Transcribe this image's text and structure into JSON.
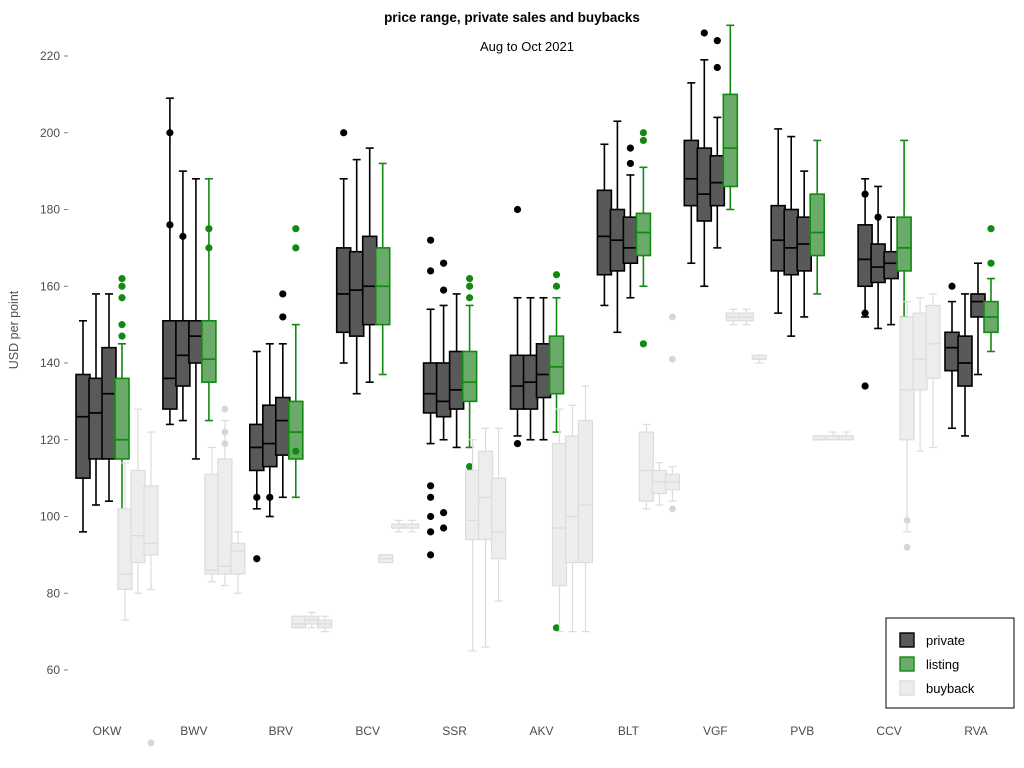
{
  "chart_data": {
    "type": "boxplot",
    "title": "price range, private sales and buybacks",
    "subtitle": "Aug to Oct 2021",
    "xlabel": "",
    "ylabel": "USD per point",
    "ylim": [
      52,
      232
    ],
    "yticks": [
      60,
      80,
      100,
      120,
      140,
      160,
      180,
      200,
      220
    ],
    "grid": false,
    "legend_position": "bottom-right",
    "legend": [
      {
        "label": "private",
        "color": "#595959",
        "border": "#000000"
      },
      {
        "label": "listing",
        "color": "#6aab6a",
        "border": "#128a12"
      },
      {
        "label": "buyback",
        "color": "#ededed",
        "border": "#dcdcdc"
      }
    ],
    "categories": [
      "OKW",
      "BWV",
      "BRV",
      "BCV",
      "SSR",
      "AKV",
      "BLT",
      "VGF",
      "PVB",
      "CCV",
      "RVA"
    ],
    "groups": [
      {
        "category": "OKW",
        "boxes": [
          {
            "series": "private",
            "min": 96,
            "q1": 110,
            "median": 126,
            "q3": 137,
            "max": 151,
            "outliers": []
          },
          {
            "series": "private",
            "min": 103,
            "q1": 115,
            "median": 127,
            "q3": 136,
            "max": 158,
            "outliers": []
          },
          {
            "series": "private",
            "min": 104,
            "q1": 115,
            "median": 132,
            "q3": 144,
            "max": 158,
            "outliers": []
          },
          {
            "series": "listing",
            "min": 99,
            "q1": 115,
            "median": 120,
            "q3": 136,
            "max": 145,
            "outliers": [
              157,
              160,
              162,
              150,
              147,
              97,
              99
            ]
          },
          {
            "series": "buyback",
            "min": 73,
            "q1": 81,
            "median": 85,
            "q3": 102,
            "max": 114,
            "outliers": []
          },
          {
            "series": "buyback",
            "min": 80,
            "q1": 88,
            "median": 95,
            "q3": 112,
            "max": 128,
            "outliers": []
          },
          {
            "series": "buyback",
            "min": 81,
            "q1": 90,
            "median": 93,
            "q3": 108,
            "max": 122,
            "outliers": [
              41
            ]
          }
        ]
      },
      {
        "category": "BWV",
        "boxes": [
          {
            "series": "private",
            "min": 124,
            "q1": 128,
            "median": 136,
            "q3": 151,
            "max": 209,
            "outliers": [
              200,
              176
            ]
          },
          {
            "series": "private",
            "min": 125,
            "q1": 134,
            "median": 142,
            "q3": 151,
            "max": 190,
            "outliers": [
              173
            ]
          },
          {
            "series": "private",
            "min": 115,
            "q1": 140,
            "median": 147,
            "q3": 151,
            "max": 188,
            "outliers": []
          },
          {
            "series": "listing",
            "min": 125,
            "q1": 135,
            "median": 141,
            "q3": 151,
            "max": 188,
            "outliers": [
              175,
              170
            ]
          },
          {
            "series": "buyback",
            "min": 83,
            "q1": 85,
            "median": 86,
            "q3": 111,
            "max": 118,
            "outliers": []
          },
          {
            "series": "buyback",
            "min": 82,
            "q1": 85,
            "median": 87,
            "q3": 115,
            "max": 125,
            "outliers": [
              119,
              122,
              128
            ]
          },
          {
            "series": "buyback",
            "min": 80,
            "q1": 85,
            "median": 91,
            "q3": 93,
            "max": 96,
            "outliers": []
          }
        ]
      },
      {
        "category": "BRV",
        "boxes": [
          {
            "series": "private",
            "min": 102,
            "q1": 112,
            "median": 118,
            "q3": 124,
            "max": 143,
            "outliers": [
              105,
              89
            ]
          },
          {
            "series": "private",
            "min": 100,
            "q1": 113,
            "median": 119,
            "q3": 129,
            "max": 145,
            "outliers": [
              105
            ]
          },
          {
            "series": "private",
            "min": 105,
            "q1": 116,
            "median": 125,
            "q3": 131,
            "max": 145,
            "outliers": [
              152,
              158
            ]
          },
          {
            "series": "listing",
            "min": 105,
            "q1": 115,
            "median": 122,
            "q3": 130,
            "max": 150,
            "outliers": [
              175,
              170,
              117
            ]
          },
          {
            "series": "buyback",
            "min": 71,
            "q1": 71,
            "median": 72,
            "q3": 74,
            "max": 74,
            "outliers": []
          },
          {
            "series": "buyback",
            "min": 71,
            "q1": 72,
            "median": 73,
            "q3": 74,
            "max": 75,
            "outliers": []
          },
          {
            "series": "buyback",
            "min": 70,
            "q1": 71,
            "median": 72,
            "q3": 73,
            "max": 74,
            "outliers": []
          }
        ]
      },
      {
        "category": "BCV",
        "boxes": [
          {
            "series": "private",
            "min": 140,
            "q1": 148,
            "median": 158,
            "q3": 170,
            "max": 188,
            "outliers": [
              200
            ]
          },
          {
            "series": "private",
            "min": 132,
            "q1": 147,
            "median": 159,
            "q3": 169,
            "max": 193,
            "outliers": []
          },
          {
            "series": "private",
            "min": 135,
            "q1": 150,
            "median": 160,
            "q3": 173,
            "max": 196,
            "outliers": []
          },
          {
            "series": "listing",
            "min": 137,
            "q1": 150,
            "median": 160,
            "q3": 170,
            "max": 192,
            "outliers": []
          },
          {
            "series": "buyback",
            "min": 88,
            "q1": 88,
            "median": 89,
            "q3": 90,
            "max": 90,
            "outliers": []
          },
          {
            "series": "buyback",
            "min": 96,
            "q1": 97,
            "median": 97,
            "q3": 98,
            "max": 99,
            "outliers": []
          },
          {
            "series": "buyback",
            "min": 96,
            "q1": 97,
            "median": 97,
            "q3": 98,
            "max": 99,
            "outliers": []
          }
        ]
      },
      {
        "category": "SSR",
        "boxes": [
          {
            "series": "private",
            "min": 119,
            "q1": 127,
            "median": 132,
            "q3": 140,
            "max": 154,
            "outliers": [
              172,
              164,
              108,
              105,
              100,
              96,
              90
            ]
          },
          {
            "series": "private",
            "min": 120,
            "q1": 126,
            "median": 130,
            "q3": 140,
            "max": 155,
            "outliers": [
              166,
              159,
              101,
              97
            ]
          },
          {
            "series": "private",
            "min": 118,
            "q1": 128,
            "median": 133,
            "q3": 143,
            "max": 158,
            "outliers": []
          },
          {
            "series": "listing",
            "min": 118,
            "q1": 130,
            "median": 135,
            "q3": 143,
            "max": 155,
            "outliers": [
              160,
              162,
              157,
              113
            ]
          },
          {
            "series": "buyback",
            "min": 65,
            "q1": 94,
            "median": 99,
            "q3": 112,
            "max": 120,
            "outliers": []
          },
          {
            "series": "buyback",
            "min": 66,
            "q1": 94,
            "median": 105,
            "q3": 117,
            "max": 123,
            "outliers": []
          },
          {
            "series": "buyback",
            "min": 78,
            "q1": 89,
            "median": 96,
            "q3": 110,
            "max": 123,
            "outliers": []
          }
        ]
      },
      {
        "category": "AKV",
        "boxes": [
          {
            "series": "private",
            "min": 121,
            "q1": 128,
            "median": 134,
            "q3": 142,
            "max": 157,
            "outliers": [
              180,
              119
            ]
          },
          {
            "series": "private",
            "min": 120,
            "q1": 128,
            "median": 135,
            "q3": 142,
            "max": 157,
            "outliers": []
          },
          {
            "series": "private",
            "min": 120,
            "q1": 131,
            "median": 137,
            "q3": 145,
            "max": 157,
            "outliers": []
          },
          {
            "series": "listing",
            "min": 122,
            "q1": 132,
            "median": 139,
            "q3": 147,
            "max": 157,
            "outliers": [
              163,
              160,
              71
            ]
          },
          {
            "series": "buyback",
            "min": 70,
            "q1": 82,
            "median": 97,
            "q3": 119,
            "max": 128,
            "outliers": []
          },
          {
            "series": "buyback",
            "min": 70,
            "q1": 88,
            "median": 100,
            "q3": 121,
            "max": 129,
            "outliers": []
          },
          {
            "series": "buyback",
            "min": 70,
            "q1": 88,
            "median": 103,
            "q3": 125,
            "max": 134,
            "outliers": []
          }
        ]
      },
      {
        "category": "BLT",
        "boxes": [
          {
            "series": "private",
            "min": 155,
            "q1": 163,
            "median": 173,
            "q3": 185,
            "max": 197,
            "outliers": []
          },
          {
            "series": "private",
            "min": 148,
            "q1": 164,
            "median": 172,
            "q3": 180,
            "max": 203,
            "outliers": []
          },
          {
            "series": "private",
            "min": 157,
            "q1": 166,
            "median": 170,
            "q3": 178,
            "max": 189,
            "outliers": [
              196,
              192
            ]
          },
          {
            "series": "listing",
            "min": 160,
            "q1": 168,
            "median": 174,
            "q3": 179,
            "max": 191,
            "outliers": [
              198,
              200,
              145
            ]
          },
          {
            "series": "buyback",
            "min": 102,
            "q1": 104,
            "median": 112,
            "q3": 122,
            "max": 124,
            "outliers": []
          },
          {
            "series": "buyback",
            "min": 103,
            "q1": 106,
            "median": 109,
            "q3": 112,
            "max": 114,
            "outliers": []
          },
          {
            "series": "buyback",
            "min": 104,
            "q1": 107,
            "median": 109,
            "q3": 111,
            "max": 113,
            "outliers": [
              102,
              152,
              141
            ]
          }
        ]
      },
      {
        "category": "VGF",
        "boxes": [
          {
            "series": "private",
            "min": 166,
            "q1": 181,
            "median": 188,
            "q3": 198,
            "max": 213,
            "outliers": []
          },
          {
            "series": "private",
            "min": 160,
            "q1": 177,
            "median": 184,
            "q3": 196,
            "max": 219,
            "outliers": [
              226
            ]
          },
          {
            "series": "private",
            "min": 170,
            "q1": 181,
            "median": 187,
            "q3": 194,
            "max": 204,
            "outliers": [
              224,
              217
            ]
          },
          {
            "series": "listing",
            "min": 180,
            "q1": 186,
            "median": 196,
            "q3": 210,
            "max": 228,
            "outliers": []
          },
          {
            "series": "buyback",
            "min": 150,
            "q1": 151,
            "median": 152,
            "q3": 153,
            "max": 154,
            "outliers": []
          },
          {
            "series": "buyback",
            "min": 150,
            "q1": 151,
            "median": 152,
            "q3": 153,
            "max": 154,
            "outliers": []
          },
          {
            "series": "buyback",
            "min": 140,
            "q1": 141,
            "median": 141,
            "q3": 142,
            "max": 142,
            "outliers": []
          }
        ]
      },
      {
        "category": "PVB",
        "boxes": [
          {
            "series": "private",
            "min": 153,
            "q1": 164,
            "median": 172,
            "q3": 181,
            "max": 201,
            "outliers": []
          },
          {
            "series": "private",
            "min": 147,
            "q1": 163,
            "median": 170,
            "q3": 180,
            "max": 199,
            "outliers": []
          },
          {
            "series": "private",
            "min": 152,
            "q1": 164,
            "median": 171,
            "q3": 178,
            "max": 190,
            "outliers": []
          },
          {
            "series": "listing",
            "min": 158,
            "q1": 168,
            "median": 174,
            "q3": 184,
            "max": 198,
            "outliers": []
          },
          {
            "series": "buyback",
            "min": 120,
            "q1": 120,
            "median": 120,
            "q3": 121,
            "max": 121,
            "outliers": []
          },
          {
            "series": "buyback",
            "min": 120,
            "q1": 120,
            "median": 121,
            "q3": 121,
            "max": 122,
            "outliers": []
          },
          {
            "series": "buyback",
            "min": 120,
            "q1": 120,
            "median": 121,
            "q3": 121,
            "max": 122,
            "outliers": []
          }
        ]
      },
      {
        "category": "CCV",
        "boxes": [
          {
            "series": "private",
            "min": 152,
            "q1": 160,
            "median": 167,
            "q3": 176,
            "max": 188,
            "outliers": [
              184,
              153,
              134
            ]
          },
          {
            "series": "private",
            "min": 149,
            "q1": 161,
            "median": 165,
            "q3": 171,
            "max": 186,
            "outliers": [
              178
            ]
          },
          {
            "series": "private",
            "min": 150,
            "q1": 162,
            "median": 166,
            "q3": 169,
            "max": 178,
            "outliers": []
          },
          {
            "series": "listing",
            "min": 152,
            "q1": 164,
            "median": 170,
            "q3": 178,
            "max": 198,
            "outliers": []
          },
          {
            "series": "buyback",
            "min": 96,
            "q1": 120,
            "median": 133,
            "q3": 152,
            "max": 156,
            "outliers": [
              99,
              92
            ]
          },
          {
            "series": "buyback",
            "min": 117,
            "q1": 133,
            "median": 141,
            "q3": 153,
            "max": 157,
            "outliers": []
          },
          {
            "series": "buyback",
            "min": 118,
            "q1": 136,
            "median": 145,
            "q3": 155,
            "max": 158,
            "outliers": []
          }
        ]
      },
      {
        "category": "RVA",
        "boxes": [
          {
            "series": "private",
            "min": 123,
            "q1": 138,
            "median": 144,
            "q3": 148,
            "max": 156,
            "outliers": [
              160
            ]
          },
          {
            "series": "private",
            "min": 121,
            "q1": 134,
            "median": 140,
            "q3": 147,
            "max": 158,
            "outliers": []
          },
          {
            "series": "private",
            "min": 137,
            "q1": 152,
            "median": 156,
            "q3": 158,
            "max": 166,
            "outliers": []
          },
          {
            "series": "listing",
            "min": 143,
            "q1": 148,
            "median": 152,
            "q3": 156,
            "max": 162,
            "outliers": [
              175,
              166
            ]
          }
        ]
      }
    ]
  }
}
